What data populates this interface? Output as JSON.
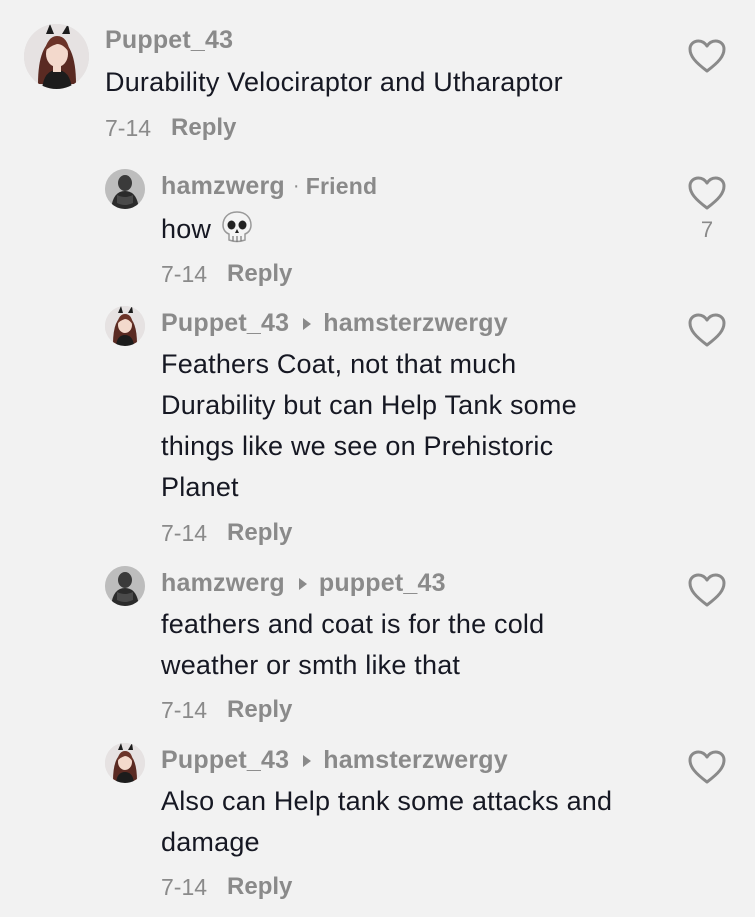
{
  "comments": [
    {
      "username": "Puppet_43",
      "text": "Durability Velociraptor and Utharaptor",
      "date": "7-14",
      "reply_label": "Reply",
      "avatar": "anime-girl-avatar",
      "like_count": ""
    },
    {
      "username": "hamzwerg",
      "separator": "·",
      "friend_label": "Friend",
      "text": "how",
      "emoji": "skull-emoji",
      "date": "7-14",
      "reply_label": "Reply",
      "avatar": "statue-avatar",
      "like_count": "7"
    },
    {
      "username": "Puppet_43",
      "reply_to": "hamsterzwergy",
      "text_lines": [
        "Feathers Coat, not that much",
        "Durability but can Help Tank some",
        "things like we see on Prehistoric",
        "Planet"
      ],
      "date": "7-14",
      "reply_label": "Reply",
      "avatar": "anime-girl-avatar"
    },
    {
      "username": "hamzwerg",
      "reply_to": "puppet_43",
      "text_lines": [
        "feathers and coat is for the cold",
        "weather or smth like that"
      ],
      "date": "7-14",
      "reply_label": "Reply",
      "avatar": "statue-avatar"
    },
    {
      "username": "Puppet_43",
      "reply_to": "hamsterzwergy",
      "text_lines": [
        "Also can Help tank some attacks and",
        "damage"
      ],
      "date": "7-14",
      "reply_label": "Reply",
      "avatar": "anime-girl-avatar"
    }
  ],
  "colors": {
    "background": "#f2f2f2",
    "text": "#161823",
    "muted": "#8a8a8a"
  }
}
